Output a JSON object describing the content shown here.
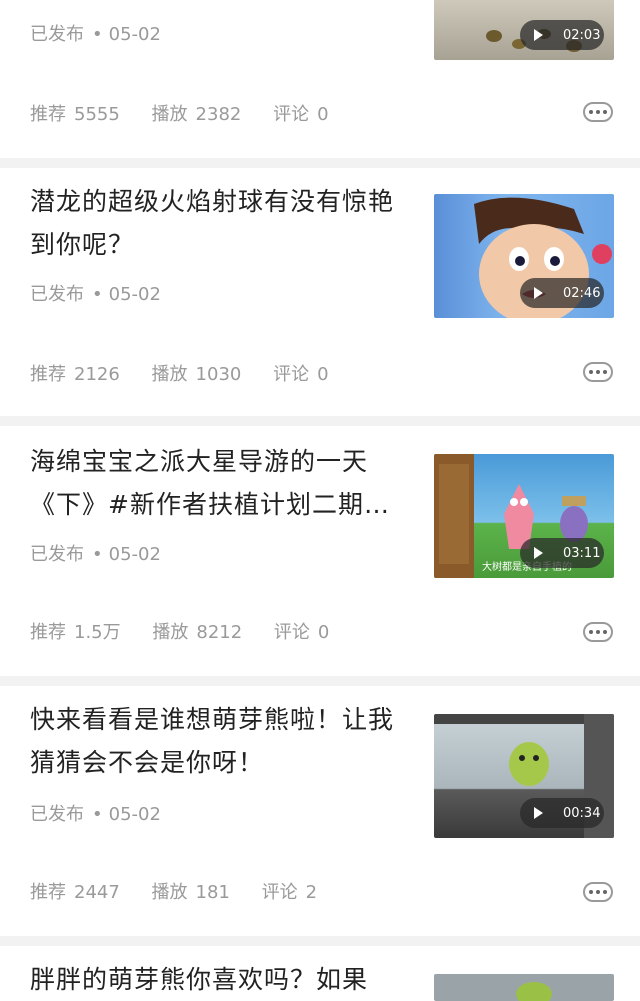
{
  "labels": {
    "published": "已发布",
    "recommend": "推荐",
    "play": "播放",
    "comment": "评论"
  },
  "colors": {
    "text": "#222222",
    "meta": "#9a9a9a",
    "divider": "#f2f2f2"
  },
  "cards": [
    {
      "title": "",
      "date": "05-02",
      "duration": "02:03",
      "recommend": "5555",
      "play": "2382",
      "comment": "0"
    },
    {
      "title": "潜龙的超级火焰射球有没有惊艳到你呢？",
      "date": "05-02",
      "duration": "02:46",
      "recommend": "2126",
      "play": "1030",
      "comment": "0"
    },
    {
      "title": "海绵宝宝之派大星导游的一天《下》#新作者扶植计划二期…",
      "date": "05-02",
      "duration": "03:11",
      "thumb_caption": "大树都是亲自手植的",
      "recommend": "1.5万",
      "play": "8212",
      "comment": "0"
    },
    {
      "title": "快来看看是谁想萌芽熊啦！让我猜猜会不会是你呀！",
      "date": "05-02",
      "duration": "00:34",
      "recommend": "2447",
      "play": "181",
      "comment": "2"
    },
    {
      "title": "胖胖的萌芽熊你喜欢吗？如果"
    }
  ]
}
